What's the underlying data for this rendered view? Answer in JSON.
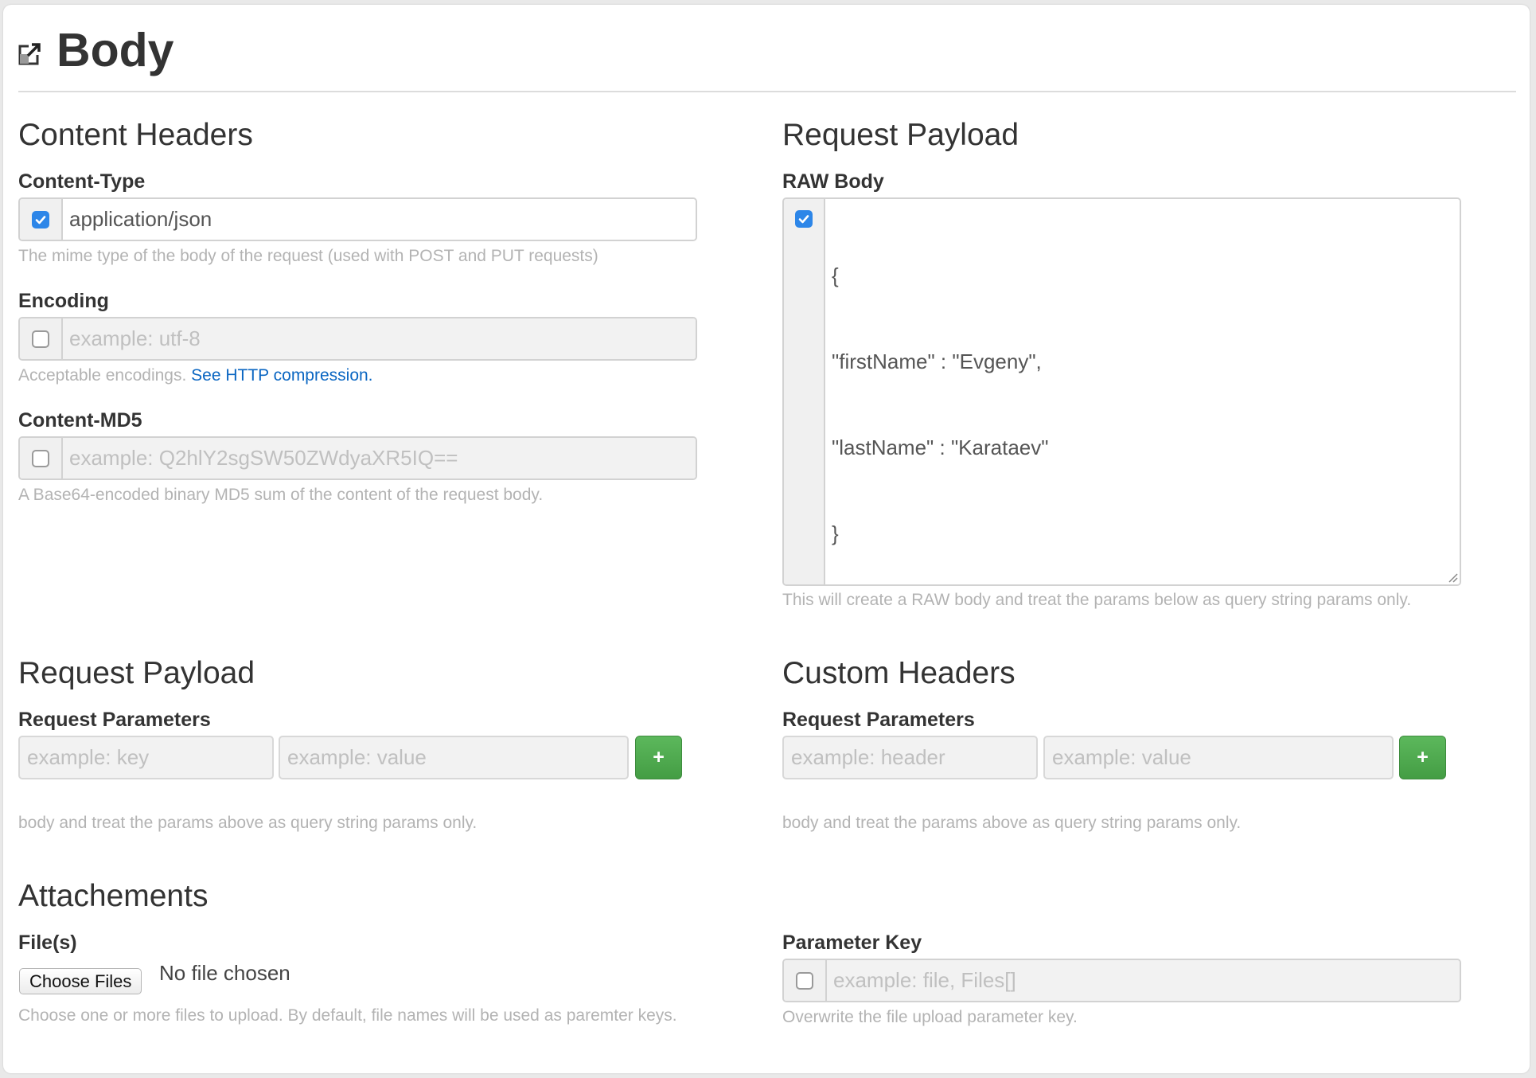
{
  "page": {
    "title": "Body",
    "icon": "external-link-icon"
  },
  "content_headers": {
    "title": "Content Headers",
    "content_type": {
      "label": "Content-Type",
      "checked": true,
      "value": "application/json",
      "help": "The mime type of the body of the request (used with POST and PUT requests)"
    },
    "encoding": {
      "label": "Encoding",
      "checked": false,
      "placeholder": "example: utf-8",
      "help": "Acceptable encodings.",
      "help_link": "See HTTP compression."
    },
    "content_md5": {
      "label": "Content-MD5",
      "checked": false,
      "placeholder": "example: Q2hlY2sgSW50ZWdyaXR5IQ==",
      "help": "A Base64-encoded binary MD5 sum of the content of the request body."
    }
  },
  "raw_payload": {
    "title": "Request Payload",
    "label": "RAW Body",
    "checked": true,
    "lines": [
      "{",
      "\"firstName\" : \"Evgeny\",",
      "\"lastName\" : \"Karataev\"",
      "}"
    ],
    "help": "This will create a RAW body and treat the params below as query string params only."
  },
  "request_payload": {
    "title": "Request Payload",
    "label": "Request Parameters",
    "key_placeholder": "example: key",
    "value_placeholder": "example: value",
    "add_label": "+",
    "help": "body and treat the params above as query string params only."
  },
  "custom_headers": {
    "title": "Custom Headers",
    "label": "Request Parameters",
    "key_placeholder": "example: header",
    "value_placeholder": "example: value",
    "add_label": "+",
    "help": "body and treat the params above as query string params only."
  },
  "attachments": {
    "title": "Attachements",
    "files_label": "File(s)",
    "choose_button": "Choose Files",
    "file_status": "No file chosen",
    "help": "Choose one or more files to upload. By default, file names will be used as paremter keys."
  },
  "parameter_key": {
    "label": "Parameter Key",
    "checked": false,
    "placeholder": "example: file, Files[]",
    "help": "Overwrite the file upload parameter key."
  },
  "colors": {
    "accent": "#2d86e8",
    "success": "#5cb85c",
    "link": "#0a66c2",
    "help_text": "#b3b3b3"
  }
}
